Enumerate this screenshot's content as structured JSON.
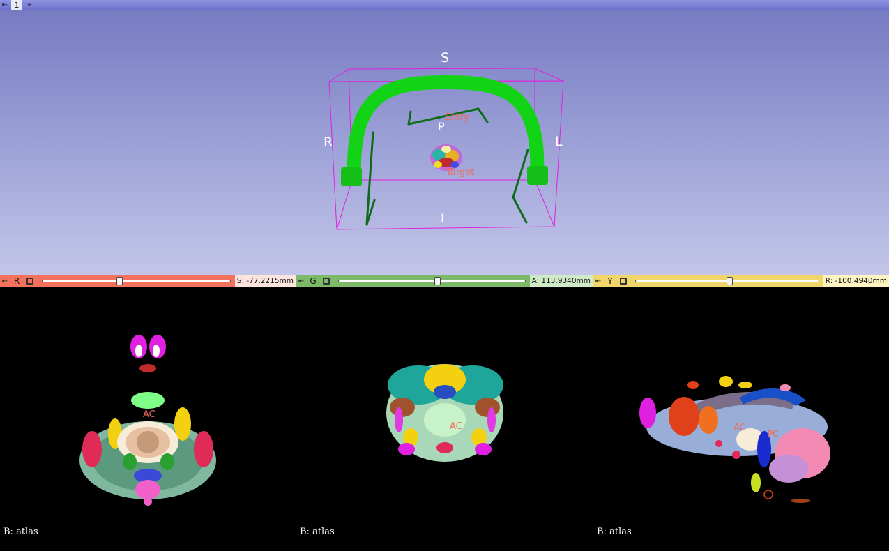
{
  "view3d": {
    "index": "1",
    "pin_icon": "pin-icon",
    "center_icon": "crosshair-icon",
    "orientation": {
      "superior": "S",
      "inferior": "I",
      "right": "R",
      "left": "L",
      "posterior": "P"
    },
    "markups": {
      "entry": "Entry",
      "target": "Target"
    },
    "colors": {
      "arc": "#13d316",
      "rods": "#0e6b1a",
      "roi_box": "#e020e0",
      "markup_text": "#f06a5a"
    }
  },
  "slices": {
    "red": {
      "label": "R",
      "offset": "S: -77.2215mm",
      "slider_fraction": 0.41,
      "layer": "B: atlas",
      "markup_label": "AC",
      "color": "#f4715e"
    },
    "green": {
      "label": "G",
      "offset": "A: 113.9340mm",
      "slider_fraction": 0.53,
      "layer": "B: atlas",
      "markup_label": "AC",
      "color": "#7cba6a"
    },
    "yellow": {
      "label": "Y",
      "offset": "R: -100.4940mm",
      "slider_fraction": 0.51,
      "layer": "B: atlas",
      "markup_label": "AC",
      "markup_label_2": "PC",
      "color": "#efd56a"
    }
  }
}
